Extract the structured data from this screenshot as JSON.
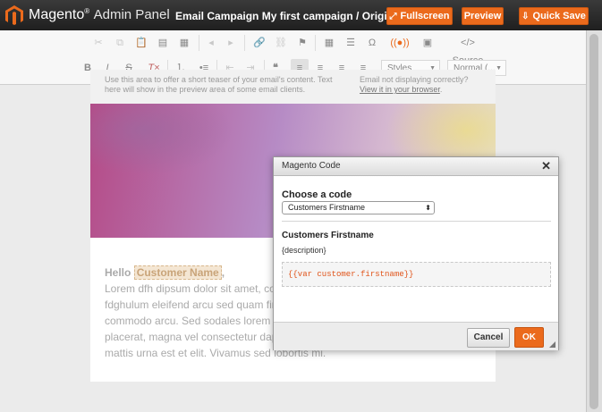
{
  "header": {
    "brand": "Magento",
    "brand_sub": "Admin Panel",
    "campaign_title": "Email Campaign My first campaign / Original",
    "fullscreen_label": "Fullscreen",
    "preview_label": "Preview",
    "quick_save_label": "Quick Save"
  },
  "toolbar": {
    "source_label": "Source",
    "styles_label": "Styles",
    "format_label": "Normal (..."
  },
  "email": {
    "preheader_text": "Use this area to offer a short teaser of your email's content. Text here will show in the preview area of some email clients.",
    "not_displaying": "Email not displaying correctly?",
    "view_in_browser": "View it in your browser",
    "view_in_browser_suffix": ".",
    "greeting": "Hello",
    "greeting_var": "Customer Name",
    "greeting_suffix": ",",
    "body": "Lorem dfh dipsum dolor sit amet, co... vel mauris scelerisque, eget tincidu... fdghulum eleifend arcu sed quam finibus, quis mollis nulla mattis. Nunc ut commodo arcu. Sed sodales lorem justo, ac elementum urna molestie eu. Proin placerat, magna vel consectetur dapibus, magna ex vulputate nibh, sit amet mattis urna est et elit. Vivamus sed lobortis mi."
  },
  "dialog": {
    "title": "Magento Code",
    "choose_label": "Choose a code",
    "selected_code": "Customers Firstname",
    "code_title": "Customers Firstname",
    "description": "{description}",
    "code_snippet": "{{var customer.firstname}}",
    "cancel_label": "Cancel",
    "ok_label": "OK"
  },
  "colors": {
    "accent": "#eb6a1c",
    "header_bg": "#2b2b2b",
    "code_text": "#e0541a"
  }
}
